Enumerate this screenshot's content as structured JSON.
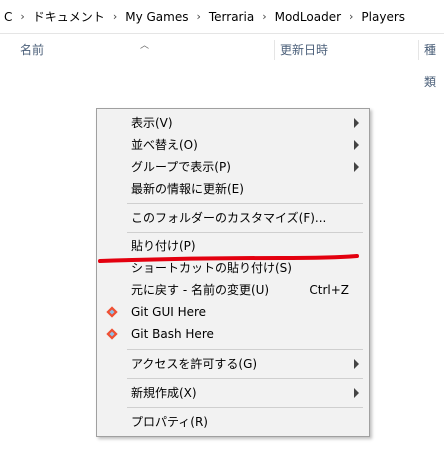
{
  "breadcrumb": {
    "items": [
      "C",
      "ドキュメント",
      "My Games",
      "Terraria",
      "ModLoader",
      "Players"
    ],
    "separator": "›"
  },
  "columns": {
    "name": "名前",
    "date": "更新日時",
    "type": "種類"
  },
  "context_menu": {
    "items": [
      {
        "label": "表示(V)",
        "submenu": true
      },
      {
        "label": "並べ替え(O)",
        "submenu": true
      },
      {
        "label": "グループで表示(P)",
        "submenu": true
      },
      {
        "label": "最新の情報に更新(E)"
      },
      {
        "label": "このフォルダーのカスタマイズ(F)..."
      },
      {
        "label": "貼り付け(P)"
      },
      {
        "label": "ショートカットの貼り付け(S)"
      },
      {
        "label": "元に戻す - 名前の変更(U)",
        "shortcut": "Ctrl+Z"
      },
      {
        "label": "Git GUI Here",
        "icon": "git-icon"
      },
      {
        "label": "Git Bash Here",
        "icon": "git-icon"
      },
      {
        "label": "アクセスを許可する(G)",
        "submenu": true
      },
      {
        "label": "新規作成(X)",
        "submenu": true
      },
      {
        "label": "プロパティ(R)"
      }
    ]
  },
  "annotation": {
    "color": "#e3000f",
    "description_target": "貼り付け(P)"
  },
  "colors": {
    "menu_bg": "#f2f2f2",
    "menu_border": "#a0a0a0",
    "column_text": "#4c607a",
    "git_orange": "#f05033"
  }
}
